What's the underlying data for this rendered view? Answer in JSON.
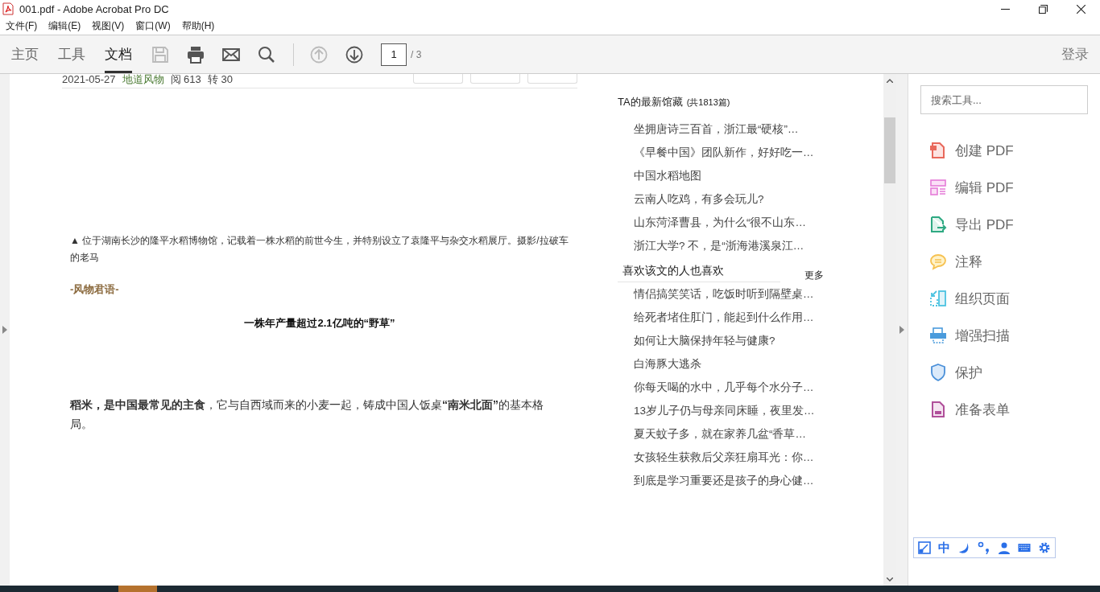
{
  "window": {
    "title": "001.pdf - Adobe Acrobat Pro DC"
  },
  "menu": [
    "文件(F)",
    "编辑(E)",
    "视图(V)",
    "窗口(W)",
    "帮助(H)"
  ],
  "tabs": [
    {
      "label": "主页",
      "selected": false
    },
    {
      "label": "工具",
      "selected": false
    },
    {
      "label": "文档",
      "selected": true
    }
  ],
  "toolbar": {
    "save_disabled": true,
    "prev_disabled": true,
    "page": "1",
    "page_total": "/ 3",
    "sign_in": "登录"
  },
  "document": {
    "meta": {
      "date": "2021-05-27",
      "source": "地道风物",
      "reads": "阅 613",
      "shares": "转 30"
    },
    "caption": "▲ 位于湖南长沙的隆平水稻博物馆，记载着一株水稻的前世今生，并特别设立了袁隆平与杂交水稻展厅。摄影/拉破车的老马",
    "section_label": "-风物君语-",
    "heading": "一株年产量超过2.1亿吨的“野草”",
    "paragraph": "**稻米，是中国最常见的主食**，它与自西域而来的小麦一起，铸成中国人饭桌**“南米北面”**的基本格局。",
    "collection": {
      "title": "TA的最新馆藏",
      "count": "(共1813篇)",
      "items": [
        "坐拥唐诗三百首，浙江最“硬核”…",
        "《早餐中国》团队新作，好好吃一…",
        "中国水稻地图",
        "云南人吃鸡，有多会玩儿?",
        "山东菏泽曹县，为什么“很不山东…",
        "浙江大学? 不，是“浙海港溪泉江…"
      ]
    },
    "related": {
      "title": "喜欢该文的人也喜欢",
      "more": "更多",
      "items": [
        "情侣搞笑笑话，吃饭时听到隔壁桌…",
        "给死者堵住肛门，能起到什么作用…",
        "如何让大脑保持年轻与健康?",
        "白海豚大逃杀",
        "你每天喝的水中，几乎每个水分子…",
        "13岁儿子仍与母亲同床睡，夜里发…",
        "夏天蚊子多，就在家养几盆“香草…",
        "女孩轻生获救后父亲狂扇耳光：你…",
        "到底是学习重要还是孩子的身心健…"
      ]
    }
  },
  "tools_pane": {
    "search": {
      "placeholder": "搜索工具..."
    },
    "tools": [
      {
        "label": "创建 PDF",
        "kind": "create"
      },
      {
        "label": "编辑 PDF",
        "kind": "edit"
      },
      {
        "label": "导出 PDF",
        "kind": "export"
      },
      {
        "label": "注释",
        "kind": "comment"
      },
      {
        "label": "组织页面",
        "kind": "organize"
      },
      {
        "label": "增强扫描",
        "kind": "scan"
      },
      {
        "label": "保护",
        "kind": "protect"
      },
      {
        "label": "准备表单",
        "kind": "form"
      }
    ]
  },
  "ime_bar": {
    "mode": "中"
  }
}
